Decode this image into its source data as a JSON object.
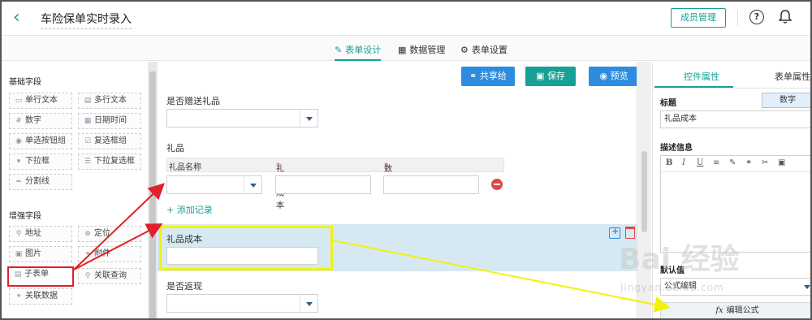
{
  "app": {
    "title": "车险保单实时录入"
  },
  "header": {
    "member_button": "成员管理",
    "help_glyph": "?",
    "more_glyph": "⋮"
  },
  "tabs": [
    {
      "label": "表单设计",
      "icon": "edit-icon",
      "active": true
    },
    {
      "label": "数据管理",
      "icon": "table-icon",
      "active": false
    },
    {
      "label": "表单设置",
      "icon": "gear-icon",
      "active": false
    }
  ],
  "sidebar": {
    "basic_title": "基础字段",
    "basic_fields": [
      "单行文本",
      "多行文本",
      "数字",
      "日期时间",
      "单选按钮组",
      "复选框组",
      "下拉框",
      "下拉复选框",
      "分割线"
    ],
    "enhanced_title": "增强字段",
    "enhanced_fields": [
      "地址",
      "定位",
      "图片",
      "附件",
      "子表单",
      "关联查询",
      "关联数据"
    ]
  },
  "toolbar": {
    "share": "共享给",
    "save": "保存",
    "preview": "预览"
  },
  "form": {
    "q_gift": "是否赠送礼品",
    "gift_label": "礼品",
    "sub_cols": [
      "礼品名称",
      "礼品成本",
      "数量"
    ],
    "req_mark": "*",
    "add_record": "添加记录",
    "selected_field": "礼品成本",
    "q_rebate": "是否返现"
  },
  "props": {
    "tab_control": "控件属性",
    "tab_form": "表单属性",
    "title_label": "标题",
    "type_tag": "数字",
    "title_value": "礼品成本",
    "desc_label": "描述信息",
    "editor_tools": [
      "B",
      "I",
      "U",
      "≡",
      "✎",
      "⚭",
      "✂",
      "▣"
    ],
    "default_label": "默认值",
    "default_value": "公式编辑",
    "formula_button": "编辑公式",
    "formula_glyph": "fx"
  },
  "watermark": {
    "text": "Bai 经验",
    "sub": "jingyan.baidu.com"
  },
  "colors": {
    "accent": "#17a096",
    "blue": "#2d8ce0",
    "danger": "#e04848",
    "highlight": "#f2f20a",
    "arrow_red": "#e0202a"
  }
}
